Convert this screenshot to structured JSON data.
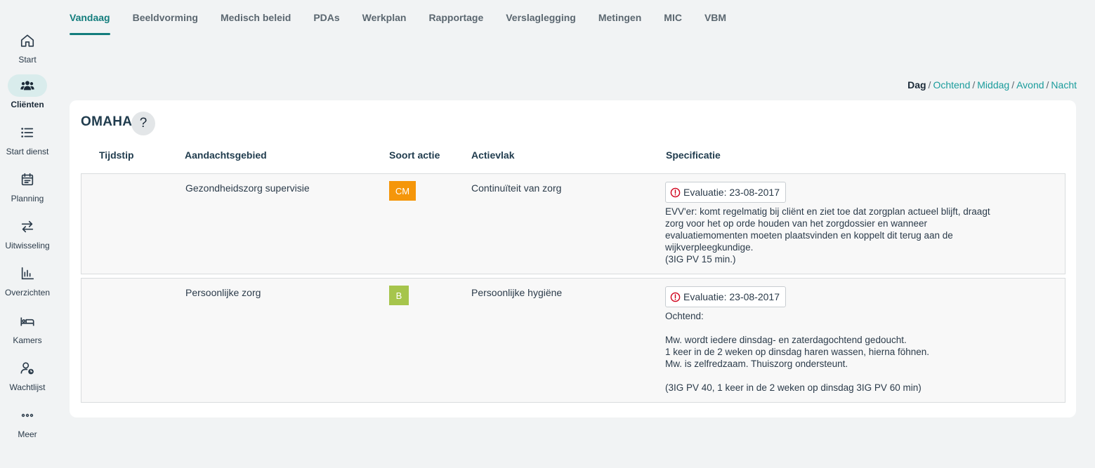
{
  "sidebar": {
    "items": [
      {
        "label": "Start",
        "icon": "home-icon"
      },
      {
        "label": "Cliënten",
        "icon": "clients-icon",
        "active": true
      },
      {
        "label": "Start dienst",
        "icon": "list-icon"
      },
      {
        "label": "Planning",
        "icon": "calendar-icon"
      },
      {
        "label": "Uitwisseling",
        "icon": "exchange-icon"
      },
      {
        "label": "Overzichten",
        "icon": "chart-icon"
      },
      {
        "label": "Kamers",
        "icon": "bed-icon"
      },
      {
        "label": "Wachtlijst",
        "icon": "waitlist-icon"
      },
      {
        "label": "Meer",
        "icon": "more-icon"
      }
    ]
  },
  "tabs": [
    {
      "label": "Vandaag",
      "active": true
    },
    {
      "label": "Beeldvorming"
    },
    {
      "label": "Medisch beleid"
    },
    {
      "label": "PDAs"
    },
    {
      "label": "Werkplan"
    },
    {
      "label": "Rapportage"
    },
    {
      "label": "Verslaglegging"
    },
    {
      "label": "Metingen"
    },
    {
      "label": "MIC"
    },
    {
      "label": "VBM"
    }
  ],
  "dayparts": {
    "current": "Dag",
    "separator": "/",
    "links": [
      "Ochtend",
      "Middag",
      "Avond",
      "Nacht"
    ]
  },
  "card": {
    "title": "OMAHA",
    "help_label": "?",
    "columns": {
      "time": "Tijdstip",
      "area": "Aandachtsgebied",
      "action": "Soort actie",
      "field": "Actievlak",
      "spec": "Specificatie"
    },
    "rows": [
      {
        "time": "",
        "area": "Gezondheidszorg supervisie",
        "action_badge": "CM",
        "action_color": "#f5960a",
        "field": "Continuïteit van zorg",
        "evaluation": "Evaluatie: 23-08-2017",
        "spec_lines": [
          "EVV'er: komt regelmatig bij cliënt en ziet toe dat zorgplan actueel blijft, draagt",
          "zorg voor het op orde houden van het zorgdossier en wanneer",
          "evaluatiemomenten moeten plaatsvinden en koppelt dit terug aan de",
          "wijkverpleegkundige.",
          "(3IG PV 15 min.)"
        ]
      },
      {
        "time": "",
        "area": "Persoonlijke zorg",
        "action_badge": "B",
        "action_color": "#a6c54c",
        "field": "Persoonlijke hygiëne",
        "evaluation": "Evaluatie: 23-08-2017",
        "spec_lines": [
          "Ochtend:",
          "",
          "Mw. wordt iedere dinsdag- en zaterdagochtend gedoucht.",
          "1 keer in de 2 weken op dinsdag haren wassen, hierna föhnen.",
          "Mw. is zelfredzaam. Thuiszorg ondersteunt.",
          "",
          "(3IG PV 40, 1 keer in de 2 weken op dinsdag 3IG PV 60 min)"
        ]
      }
    ]
  },
  "colors": {
    "accent": "#137d7d",
    "link": "#1a9c9c",
    "alert": "#d0021b"
  }
}
